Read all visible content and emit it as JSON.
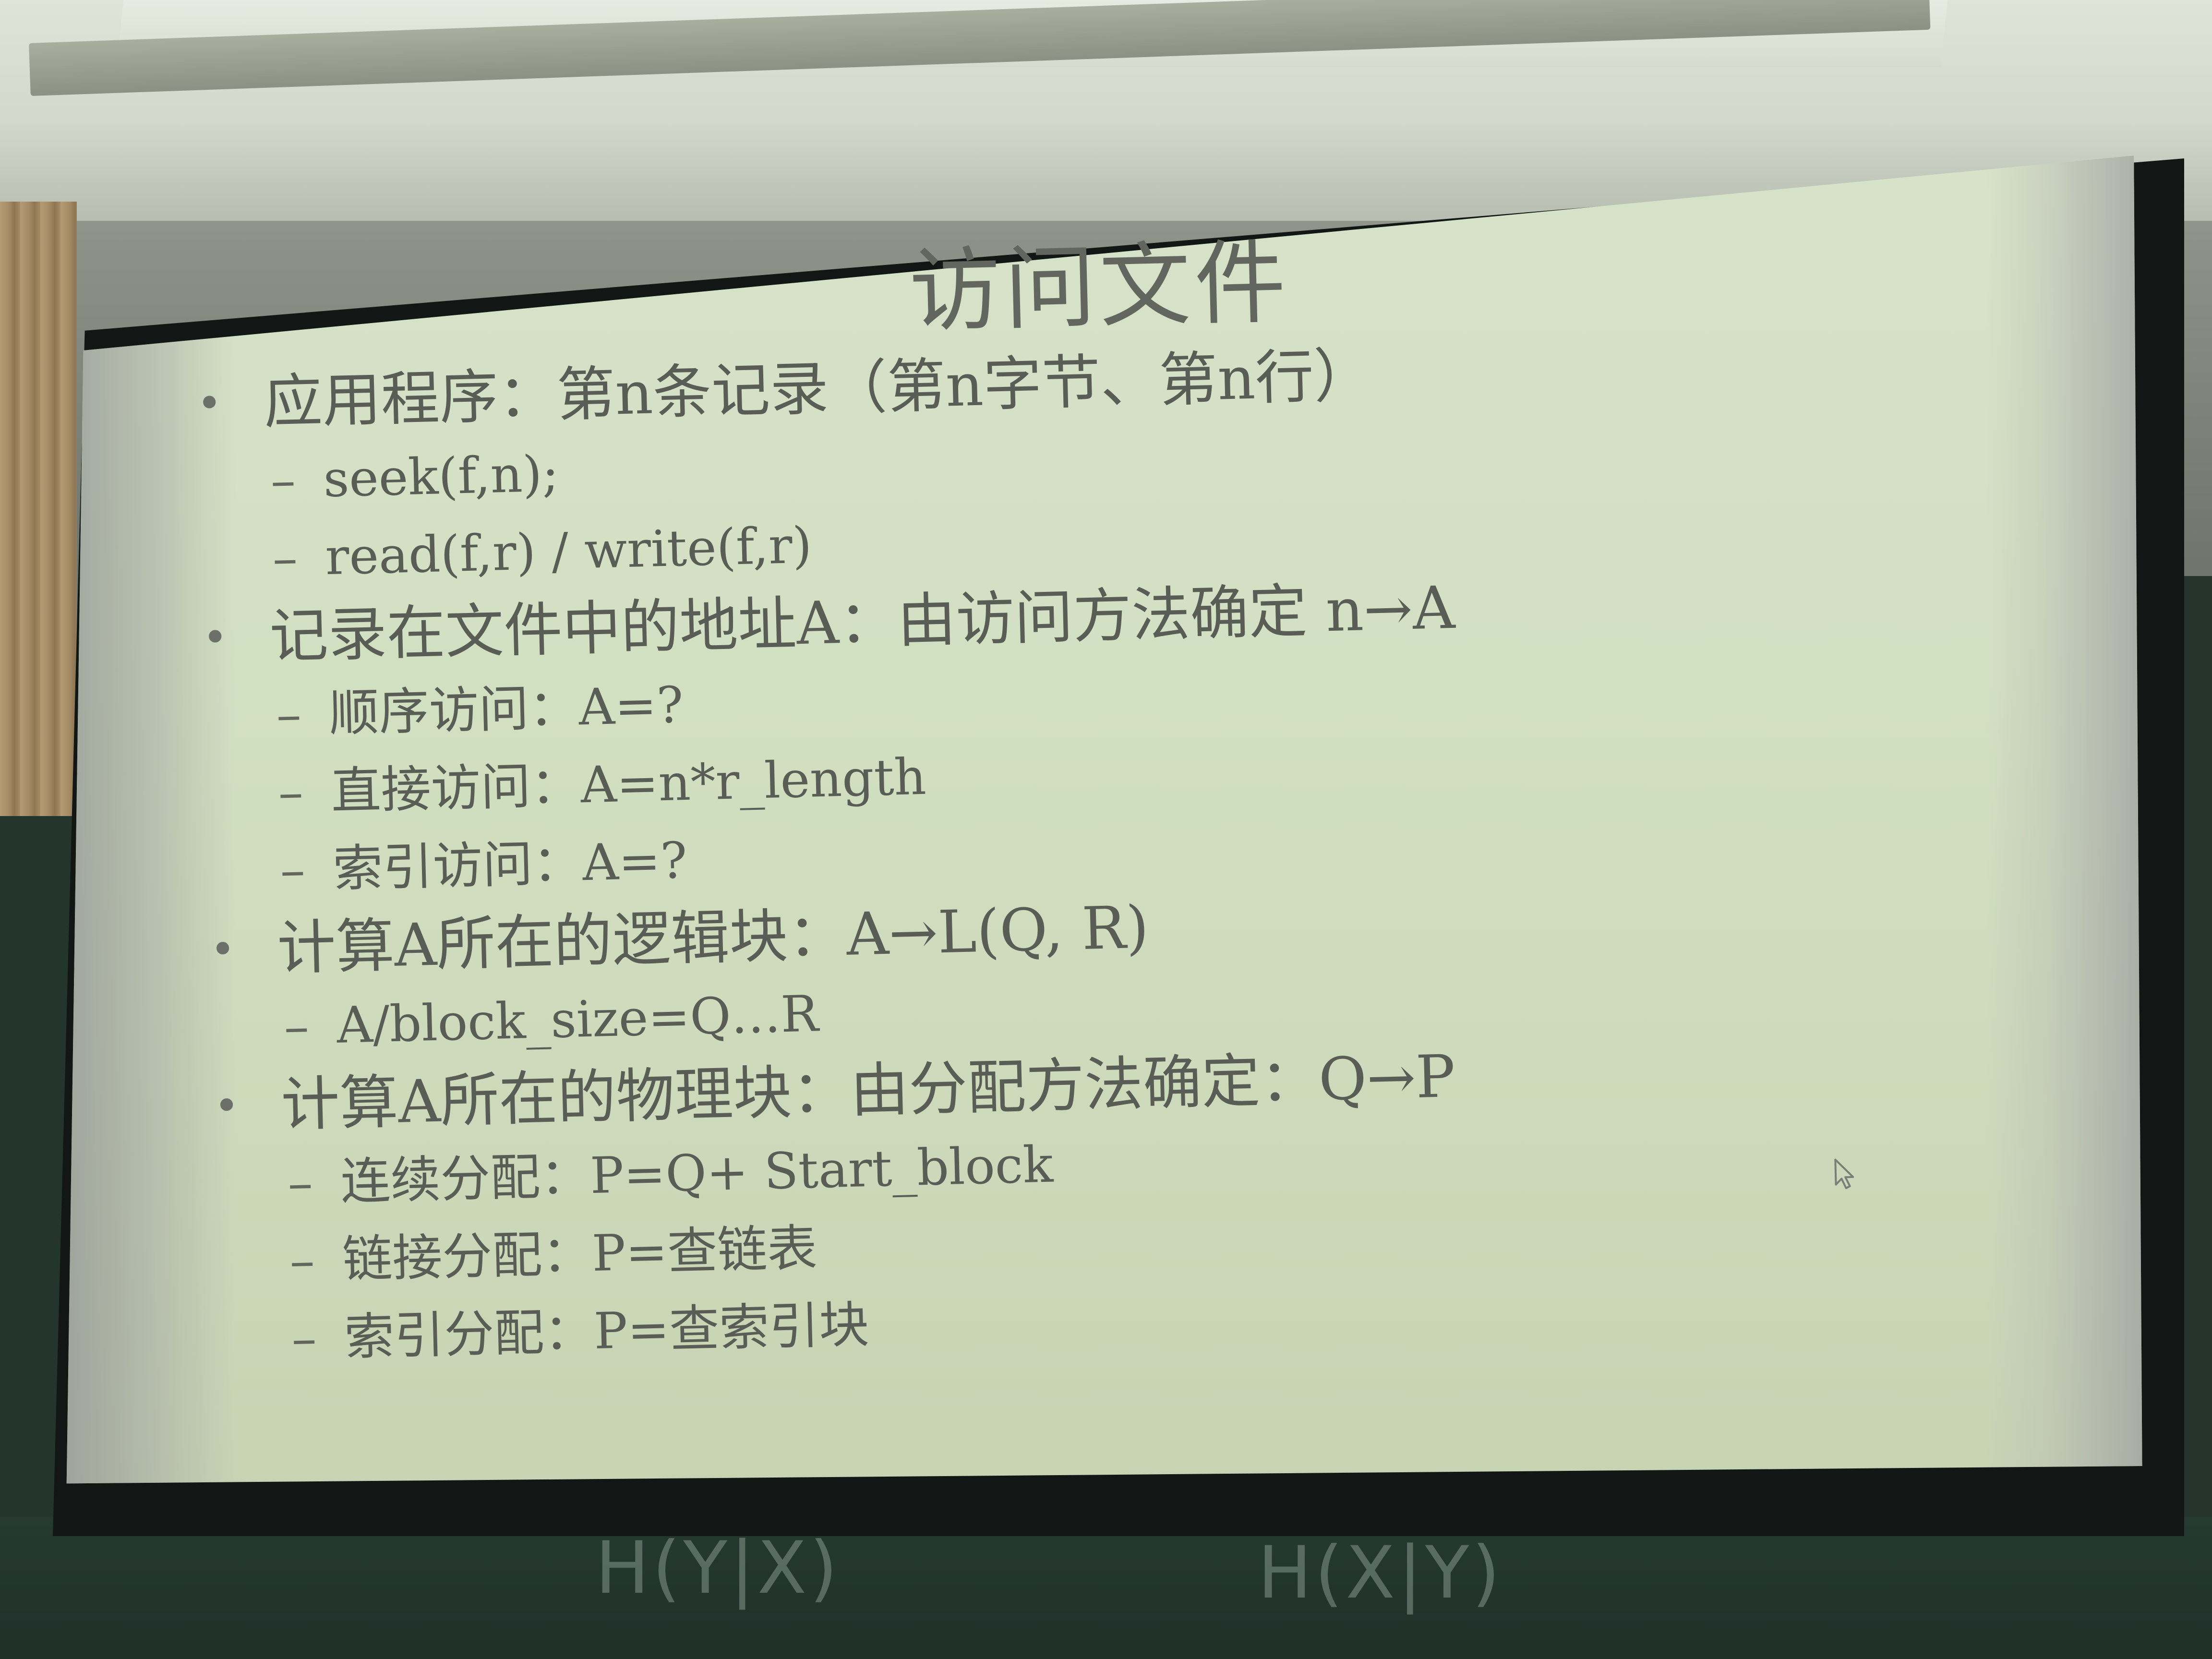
{
  "slide": {
    "title": "访问文件",
    "items": [
      {
        "level": 1,
        "text": "应用程序：第n条记录（第n字节、第n行）"
      },
      {
        "level": 2,
        "text": "seek(f,n);"
      },
      {
        "level": 2,
        "text": "read(f,r)  /  write(f,r)"
      },
      {
        "level": 1,
        "text": "记录在文件中的地址A：由访问方法确定 n→A"
      },
      {
        "level": 2,
        "text": "顺序访问：A=?"
      },
      {
        "level": 2,
        "text": "直接访问：A=n*r_length"
      },
      {
        "level": 2,
        "text": "索引访问：A=?"
      },
      {
        "level": 1,
        "text": "计算A所在的逻辑块：A→L(Q, R)"
      },
      {
        "level": 2,
        "text": "A/block_size=Q…R"
      },
      {
        "level": 1,
        "text": "计算A所在的物理块：由分配方法确定：Q→P"
      },
      {
        "level": 2,
        "text": "连续分配：P=Q+ Start_block"
      },
      {
        "level": 2,
        "text": "链接分配：P=查链表"
      },
      {
        "level": 2,
        "text": "索引分配：P=查索引块"
      }
    ],
    "bullet_symbol": "•",
    "dash_symbol": "–"
  },
  "chalkboard": {
    "left_text": "H(Y|X)",
    "right_text": "H(X|Y)"
  },
  "colors": {
    "slide_background": "#d2e0c2",
    "slide_text": "#595d55",
    "chalkboard": "#24352d"
  },
  "icons": [
    "mouse-pointer-icon"
  ]
}
